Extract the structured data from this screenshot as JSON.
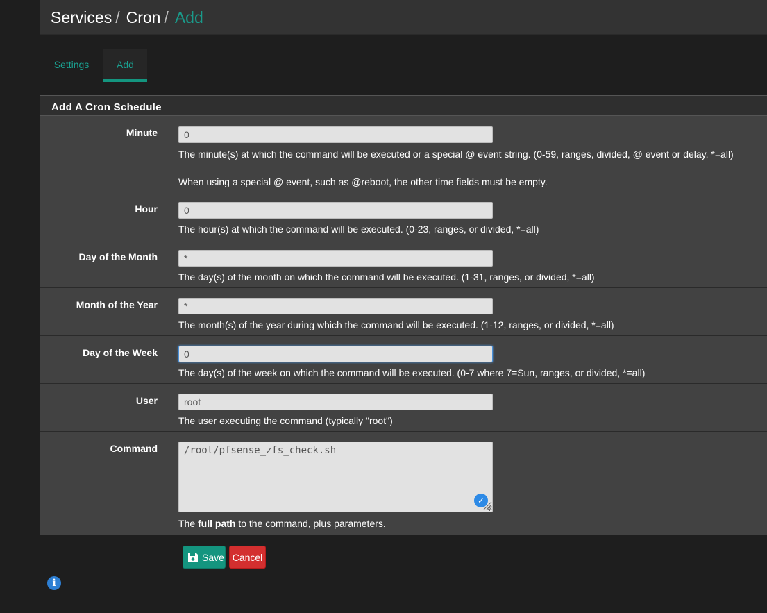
{
  "breadcrumb": {
    "part1": "Services",
    "part2": "Cron",
    "part3": "Add",
    "separator": "/"
  },
  "tabs": [
    {
      "label": "Settings"
    },
    {
      "label": "Add"
    }
  ],
  "panel": {
    "title": "Add A Cron Schedule"
  },
  "fields": {
    "minute": {
      "label": "Minute",
      "value": "0",
      "help1": "The minute(s) at which the command will be executed or a special @ event string. (0-59, ranges, divided, @ event or delay, *=all)",
      "help2": "When using a special @ event, such as @reboot, the other time fields must be empty."
    },
    "hour": {
      "label": "Hour",
      "value": "0",
      "help": "The hour(s) at which the command will be executed. (0-23, ranges, or divided, *=all)"
    },
    "mday": {
      "label": "Day of the Month",
      "value": "*",
      "help": "The day(s) of the month on which the command will be executed. (1-31, ranges, or divided, *=all)"
    },
    "month": {
      "label": "Month of the Year",
      "value": "*",
      "help": "The month(s) of the year during which the command will be executed. (1-12, ranges, or divided, *=all)"
    },
    "wday": {
      "label": "Day of the Week",
      "value": "0",
      "help": "The day(s) of the week on which the command will be executed. (0-7 where 7=Sun, ranges, or divided, *=all)"
    },
    "user": {
      "label": "User",
      "value": "root",
      "help": "The user executing the command (typically \"root\")"
    },
    "command": {
      "label": "Command",
      "value": "/root/pfsense_zfs_check.sh",
      "help_prefix": "The ",
      "help_bold": "full path",
      "help_suffix": " to the command, plus parameters."
    }
  },
  "buttons": {
    "save": "Save",
    "cancel": "Cancel"
  },
  "icons": {
    "info": "info-icon",
    "save": "save-icon",
    "check": "checkmark-badge-icon"
  },
  "colors": {
    "accent": "#14957f",
    "danger": "#d32f2f",
    "info": "#2d7fd3"
  }
}
